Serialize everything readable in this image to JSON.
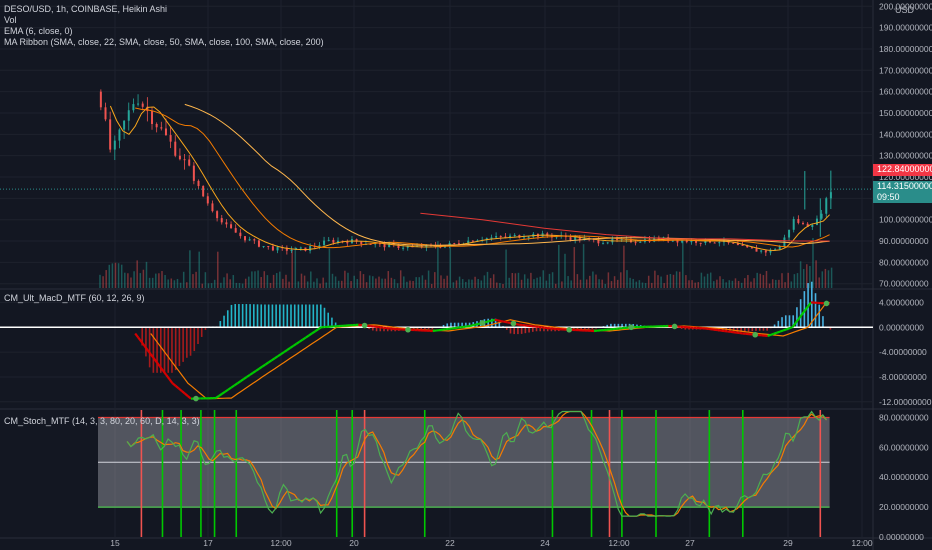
{
  "legend": {
    "symbol": "DESO/USD, 1h, COINBASE, Heikin Ashi",
    "vol": "Vol",
    "ema": "EMA (6, close, 0)",
    "ribbon": "MA Ribbon (SMA, close, 22, SMA, close, 50, SMA, close, 100, SMA, close, 200)",
    "macd": "CM_Ult_MacD_MTF (60, 12, 26, 9)",
    "stoch": "CM_Stoch_MTF (14, 3, 3, 80, 20, 60, D, 14, 3, 3)"
  },
  "axis": {
    "currency": "USD",
    "price_ticks": [
      "200.00000000",
      "190.00000000",
      "180.00000000",
      "170.00000000",
      "160.00000000",
      "150.00000000",
      "140.00000000",
      "130.00000000",
      "120.00000000",
      "110.00000000",
      "100.00000000",
      "90.00000000",
      "80.00000000",
      "70.00000000"
    ],
    "macd_ticks": [
      "4.00000000",
      "0.00000000",
      "-4.00000000",
      "-8.00000000",
      "-12.00000000"
    ],
    "stoch_ticks": [
      "80.00000000",
      "60.00000000",
      "40.00000000",
      "20.00000000",
      "0.00000000"
    ],
    "time_ticks": [
      "15",
      "17",
      "12:00",
      "20",
      "22",
      "24",
      "12:00",
      "27",
      "29",
      "12:00"
    ]
  },
  "tags": {
    "high": "122.84000000",
    "last": "114.31500000",
    "countdown": "09:50"
  },
  "colors": {
    "bg": "#131722",
    "up": "#26a69a",
    "down": "#ef5350",
    "ema": "#f7a51b",
    "ribbon_slow": "#e53935",
    "macd_up": "#00c800",
    "macd_down": "#d50000",
    "stoch_k": "#4caf50",
    "stoch_d": "#f57c00",
    "band": "#787b86"
  },
  "chart_data": [
    {
      "type": "candlestick",
      "title": "DESO/USD, 1h, COINBASE, Heikin Ashi",
      "ylim": [
        68,
        202
      ],
      "x_labels": [
        "15",
        "17",
        "12:00",
        "20",
        "22",
        "24",
        "12:00",
        "27",
        "29",
        "12:00"
      ],
      "close_series": [
        {
          "t": 0,
          "v": 160
        },
        {
          "t": 2,
          "v": 130
        },
        {
          "t": 4,
          "v": 145
        },
        {
          "t": 6,
          "v": 158
        },
        {
          "t": 8,
          "v": 150
        },
        {
          "t": 11,
          "v": 138
        },
        {
          "t": 14,
          "v": 126
        },
        {
          "t": 17,
          "v": 110
        },
        {
          "t": 20,
          "v": 98
        },
        {
          "t": 23,
          "v": 92
        },
        {
          "t": 26,
          "v": 88
        },
        {
          "t": 29,
          "v": 86
        },
        {
          "t": 33,
          "v": 86
        },
        {
          "t": 37,
          "v": 90
        },
        {
          "t": 41,
          "v": 90
        },
        {
          "t": 46,
          "v": 88
        },
        {
          "t": 51,
          "v": 87
        },
        {
          "t": 56,
          "v": 88
        },
        {
          "t": 61,
          "v": 91
        },
        {
          "t": 66,
          "v": 92
        },
        {
          "t": 70,
          "v": 93
        },
        {
          "t": 75,
          "v": 92
        },
        {
          "t": 80,
          "v": 90
        },
        {
          "t": 85,
          "v": 90
        },
        {
          "t": 90,
          "v": 91
        },
        {
          "t": 95,
          "v": 90
        },
        {
          "t": 100,
          "v": 90
        },
        {
          "t": 105,
          "v": 86
        },
        {
          "t": 108,
          "v": 85
        },
        {
          "t": 110,
          "v": 88
        },
        {
          "t": 112,
          "v": 100
        },
        {
          "t": 114,
          "v": 97
        },
        {
          "t": 116,
          "v": 100
        },
        {
          "t": 118,
          "v": 114
        }
      ],
      "sma_slow": [
        {
          "t": 52,
          "v": 103
        },
        {
          "t": 62,
          "v": 100
        },
        {
          "t": 72,
          "v": 96
        },
        {
          "t": 82,
          "v": 93
        },
        {
          "t": 92,
          "v": 91
        },
        {
          "t": 102,
          "v": 91
        },
        {
          "t": 112,
          "v": 90
        },
        {
          "t": 118,
          "v": 90
        }
      ],
      "last_price": 114.315,
      "high_marker": 122.84
    },
    {
      "type": "line",
      "title": "CM_Ult_MacD_MTF (60, 12, 26, 9)",
      "ylim": [
        -13,
        6
      ],
      "ticks": [
        4,
        0,
        -4,
        -8,
        -12
      ],
      "macd": [
        {
          "t": 6,
          "v": -1
        },
        {
          "t": 9,
          "v": -5
        },
        {
          "t": 12,
          "v": -9
        },
        {
          "t": 15,
          "v": -11.5
        },
        {
          "t": 19,
          "v": -11.4
        },
        {
          "t": 24,
          "v": -8
        },
        {
          "t": 30,
          "v": -4
        },
        {
          "t": 36,
          "v": 0
        },
        {
          "t": 42,
          "v": 0.4
        },
        {
          "t": 48,
          "v": -0.3
        },
        {
          "t": 54,
          "v": -0.6
        },
        {
          "t": 60,
          "v": 0.2
        },
        {
          "t": 64,
          "v": 1.2
        },
        {
          "t": 68,
          "v": 0.4
        },
        {
          "t": 74,
          "v": -0.3
        },
        {
          "t": 80,
          "v": -0.6
        },
        {
          "t": 86,
          "v": 0
        },
        {
          "t": 92,
          "v": 0.2
        },
        {
          "t": 98,
          "v": -0.2
        },
        {
          "t": 104,
          "v": -1
        },
        {
          "t": 108,
          "v": -1.4
        },
        {
          "t": 112,
          "v": 0
        },
        {
          "t": 115,
          "v": 4
        },
        {
          "t": 118,
          "v": 3.8
        }
      ]
    },
    {
      "type": "line",
      "title": "CM_Stoch_MTF (14, 3, 3, 80, 20, 60, D, 14, 3, 3)",
      "ylim": [
        0,
        85
      ],
      "ticks": [
        80,
        60,
        40,
        20,
        0
      ],
      "bands": [
        20,
        50,
        80
      ]
    }
  ]
}
